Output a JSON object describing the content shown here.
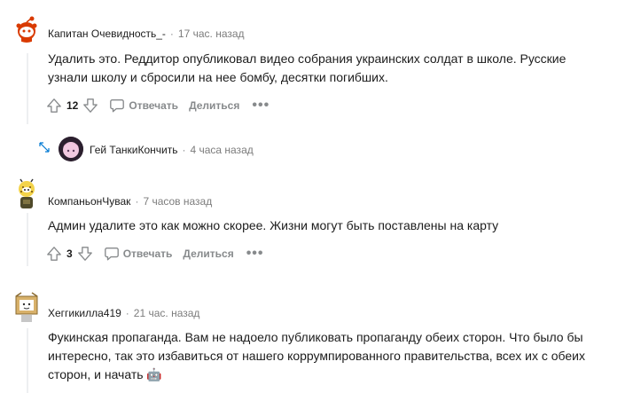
{
  "comments": [
    {
      "author": "Капитан Очевидность_-",
      "separator": "·",
      "time": "17 час. назад",
      "body": "Удалить это. Реддитор опубликовал видео собрания украинских солдат в школе. Русские узнали школу и сбросили на нее бомбу, десятки погибших.",
      "score": "12",
      "reply_label": "Отвечать",
      "share_label": "Делиться"
    },
    {
      "author": "КомпаньонЧувак",
      "separator": "·",
      "time": "7 часов назад",
      "body": "Админ удалите это как можно скорее. Жизни могут быть поставлены на карту",
      "score": "3",
      "reply_label": "Отвечать",
      "share_label": "Делиться"
    },
    {
      "author": "Хеггикилла419",
      "separator": "·",
      "time": "21 час. назад",
      "body": "Фукинская пропаганда. Вам не надоело публиковать пропаганду обеих сторон. Что было бы интересно, так это избавиться от нашего коррумпированного правительства, всех их с обеих сторон, и начать 🤖"
    }
  ],
  "collapsed_reply": {
    "author": "Гей ТанкиКончить",
    "separator": "·",
    "time": "4 часа назад"
  },
  "icons": {
    "upvote": "arrow-up-icon",
    "downvote": "arrow-down-icon",
    "reply": "speech-bubble-icon",
    "more": "ellipsis-icon",
    "expand": "expand-arrows-icon"
  },
  "colors": {
    "meta_gray": "#878a8c",
    "text": "#1c1c1c",
    "thread_line": "#edeff1",
    "expand_blue": "#0079d3"
  }
}
